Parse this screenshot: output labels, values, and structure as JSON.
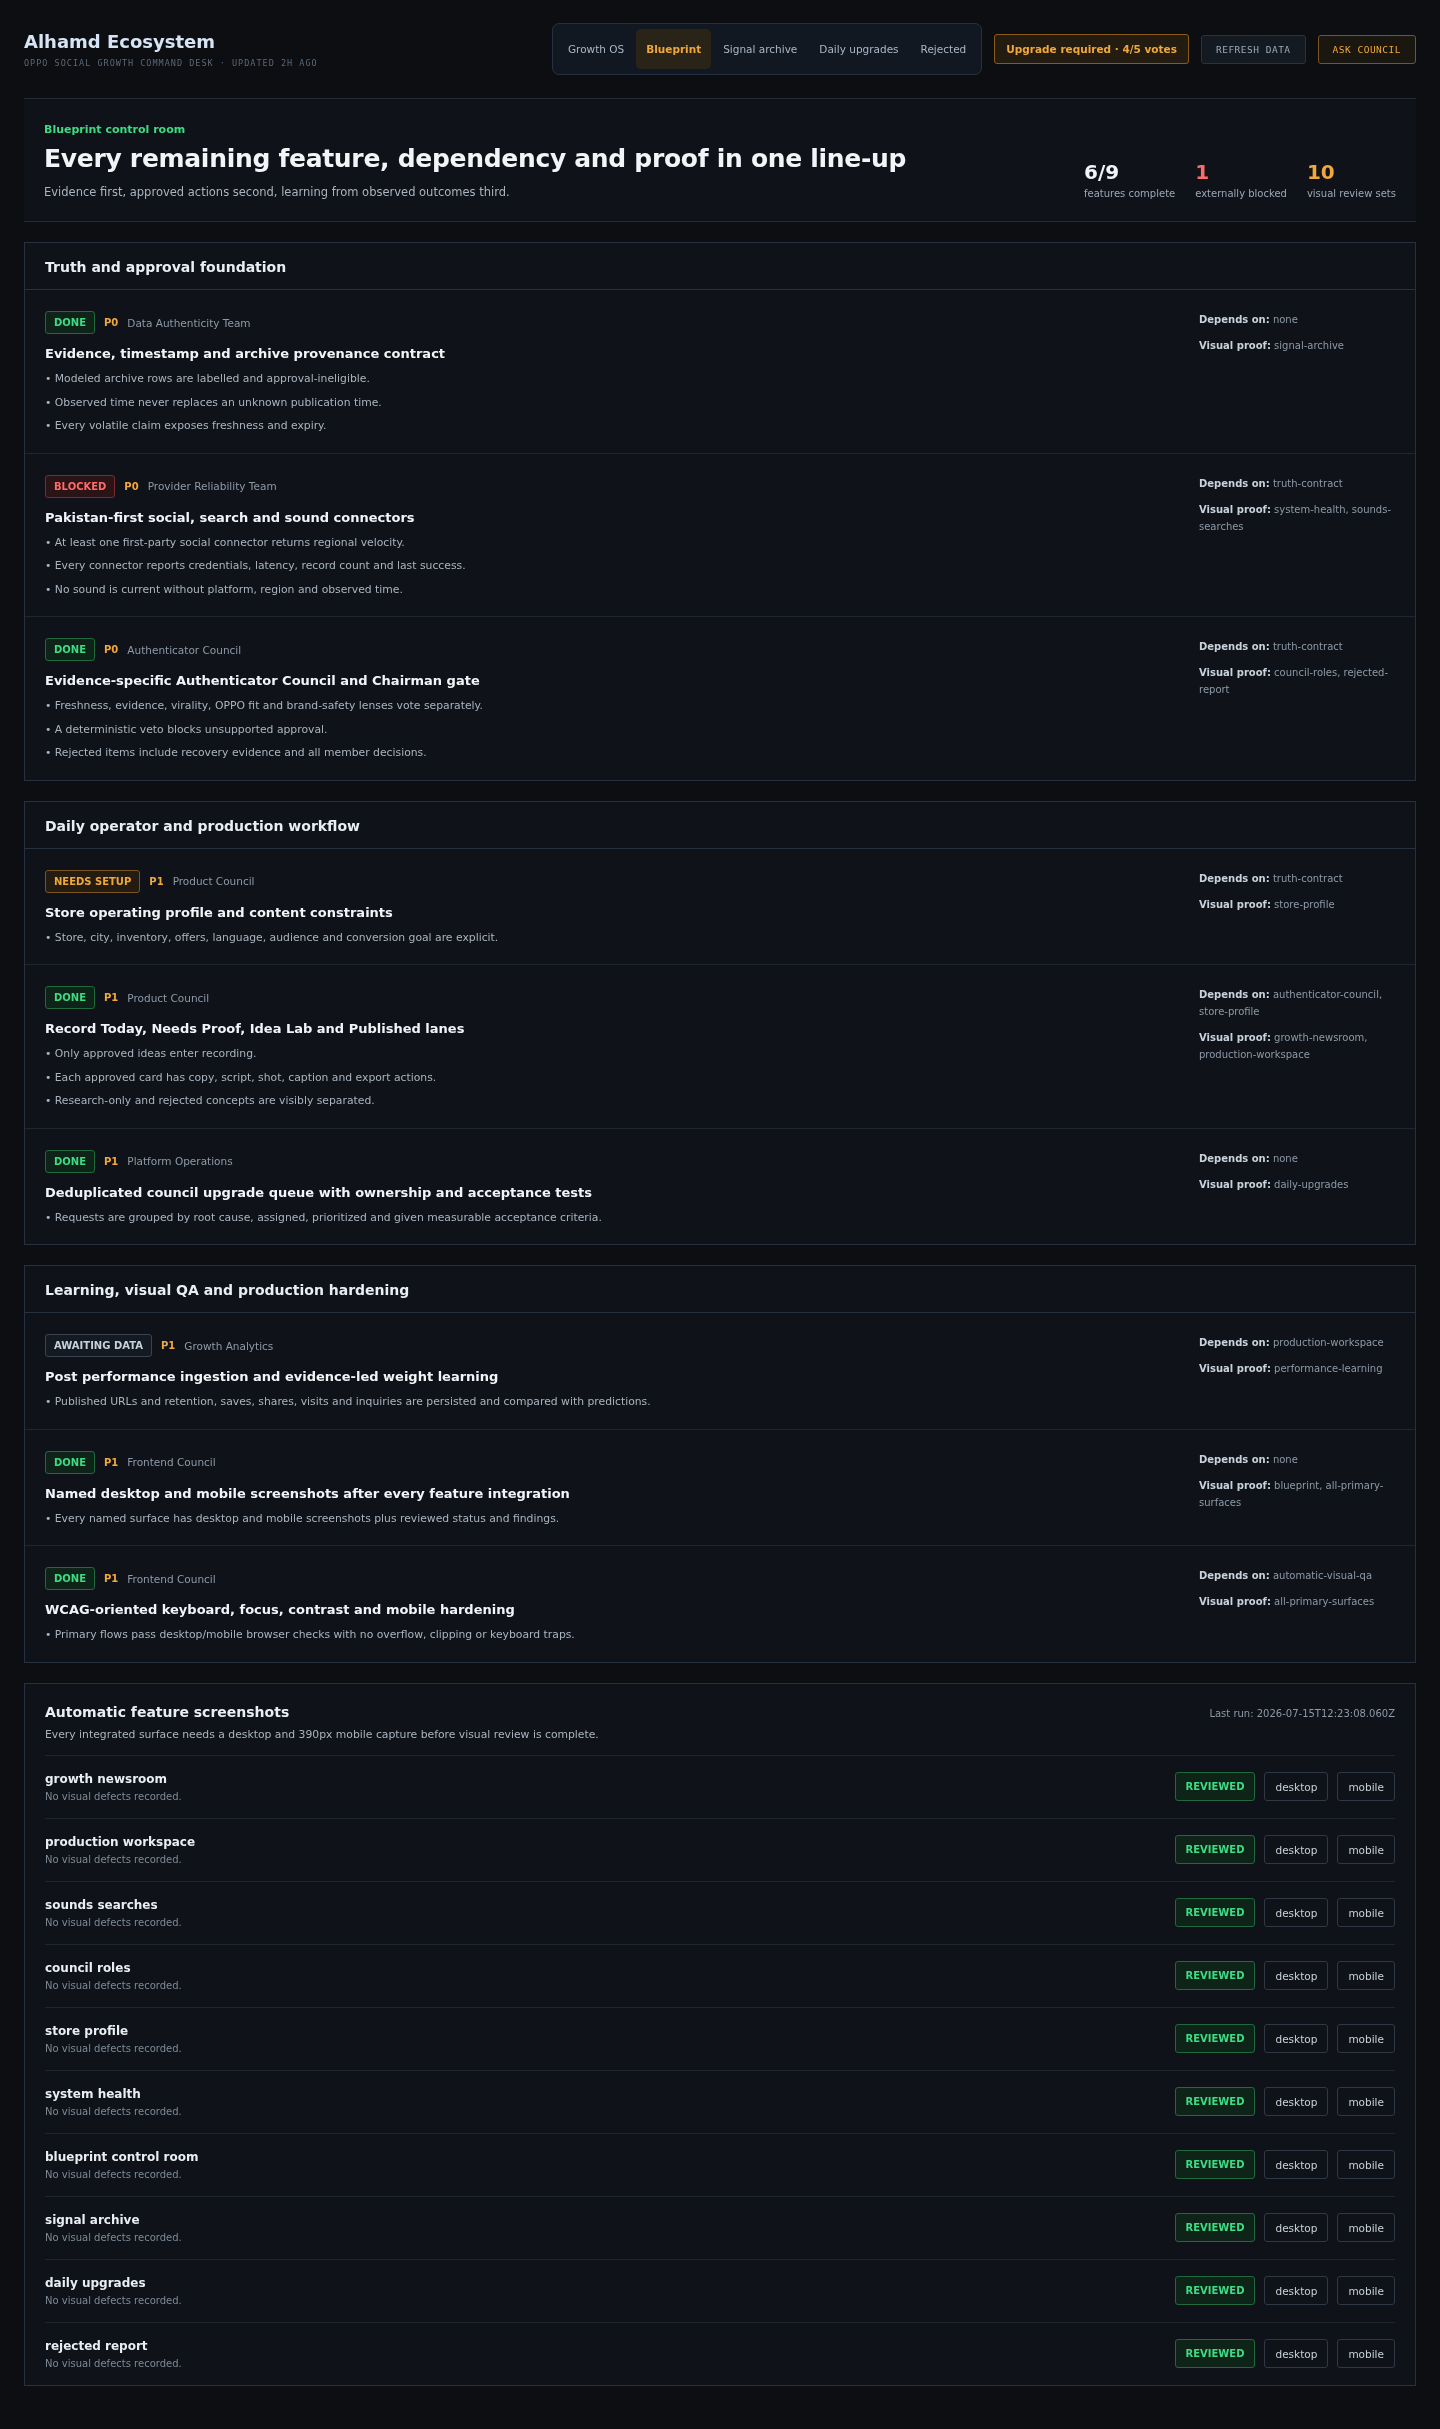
{
  "header": {
    "title": "Alhamd Ecosystem",
    "subtitle": "OPPO SOCIAL GROWTH COMMAND DESK · UPDATED 2H AGO",
    "tabs": [
      {
        "label": "Growth OS",
        "selected": false
      },
      {
        "label": "Blueprint",
        "selected": true
      },
      {
        "label": "Signal archive",
        "selected": false
      },
      {
        "label": "Daily upgrades",
        "selected": false
      },
      {
        "label": "Rejected",
        "selected": false
      }
    ],
    "upgrade_notice": "Upgrade required · 4/5 votes",
    "refresh_button": "REFRESH DATA",
    "ask_button": "ASK COUNCIL"
  },
  "hero": {
    "eyebrow": "Blueprint control room",
    "title": "Every remaining feature, dependency and proof in one line-up",
    "subtitle": "Evidence first, approved actions second, learning from observed outcomes third.",
    "stats": [
      {
        "value": "6/9",
        "label": "features complete",
        "kind": "neutral"
      },
      {
        "value": "1",
        "label": "externally blocked",
        "kind": "danger"
      },
      {
        "value": "10",
        "label": "visual review sets",
        "kind": "warning"
      }
    ]
  },
  "sections": [
    {
      "title": "Truth and approval foundation",
      "features": [
        {
          "kind": "done",
          "status_label": "DONE",
          "priority": "P0",
          "owner": "Data Authenticity Team",
          "title": "Evidence, timestamp and archive provenance contract",
          "bullets": [
            "• Modeled archive rows are labelled and approval-ineligible.",
            "• Observed time never replaces an unknown publication time.",
            "• Every volatile claim exposes freshness and expiry."
          ],
          "depends_label": "Depends on:",
          "depends": "none",
          "proof_label": "Visual proof:",
          "proof": "signal-archive"
        },
        {
          "kind": "blocked",
          "status_label": "BLOCKED",
          "priority": "P0",
          "owner": "Provider Reliability Team",
          "title": "Pakistan-first social, search and sound connectors",
          "bullets": [
            "• At least one first-party social connector returns regional velocity.",
            "• Every connector reports credentials, latency, record count and last success.",
            "• No sound is current without platform, region and observed time."
          ],
          "depends_label": "Depends on:",
          "depends": "truth-contract",
          "proof_label": "Visual proof:",
          "proof": "system-health, sounds-searches"
        },
        {
          "kind": "done",
          "status_label": "DONE",
          "priority": "P0",
          "owner": "Authenticator Council",
          "title": "Evidence-specific Authenticator Council and Chairman gate",
          "bullets": [
            "• Freshness, evidence, virality, OPPO fit and brand-safety lenses vote separately.",
            "• A deterministic veto blocks unsupported approval.",
            "• Rejected items include recovery evidence and all member decisions."
          ],
          "depends_label": "Depends on:",
          "depends": "truth-contract",
          "proof_label": "Visual proof:",
          "proof": "council-roles, rejected-report"
        }
      ]
    },
    {
      "title": "Daily operator and production workflow",
      "features": [
        {
          "kind": "needs_setup",
          "status_label": "NEEDS SETUP",
          "priority": "P1",
          "owner": "Product Council",
          "title": "Store operating profile and content constraints",
          "bullets": [
            "• Store, city, inventory, offers, language, audience and conversion goal are explicit."
          ],
          "depends_label": "Depends on:",
          "depends": "truth-contract",
          "proof_label": "Visual proof:",
          "proof": "store-profile"
        },
        {
          "kind": "done",
          "status_label": "DONE",
          "priority": "P1",
          "owner": "Product Council",
          "title": "Record Today, Needs Proof, Idea Lab and Published lanes",
          "bullets": [
            "• Only approved ideas enter recording.",
            "• Each approved card has copy, script, shot, caption and export actions.",
            "• Research-only and rejected concepts are visibly separated."
          ],
          "depends_label": "Depends on:",
          "depends": "authenticator-council, store-profile",
          "proof_label": "Visual proof:",
          "proof": "growth-newsroom, production-workspace"
        },
        {
          "kind": "done",
          "status_label": "DONE",
          "priority": "P1",
          "owner": "Platform Operations",
          "title": "Deduplicated council upgrade queue with ownership and acceptance tests",
          "bullets": [
            "• Requests are grouped by root cause, assigned, prioritized and given measurable acceptance criteria."
          ],
          "depends_label": "Depends on:",
          "depends": "none",
          "proof_label": "Visual proof:",
          "proof": "daily-upgrades"
        }
      ]
    },
    {
      "title": "Learning, visual QA and production hardening",
      "features": [
        {
          "kind": "awaiting_data",
          "status_label": "AWAITING DATA",
          "priority": "P1",
          "owner": "Growth Analytics",
          "title": "Post performance ingestion and evidence-led weight learning",
          "bullets": [
            "• Published URLs and retention, saves, shares, visits and inquiries are persisted and compared with predictions."
          ],
          "depends_label": "Depends on:",
          "depends": "production-workspace",
          "proof_label": "Visual proof:",
          "proof": "performance-learning"
        },
        {
          "kind": "done",
          "status_label": "DONE",
          "priority": "P1",
          "owner": "Frontend Council",
          "title": "Named desktop and mobile screenshots after every feature integration",
          "bullets": [
            "• Every named surface has desktop and mobile screenshots plus reviewed status and findings."
          ],
          "depends_label": "Depends on:",
          "depends": "none",
          "proof_label": "Visual proof:",
          "proof": "blueprint, all-primary-surfaces"
        },
        {
          "kind": "done",
          "status_label": "DONE",
          "priority": "P1",
          "owner": "Frontend Council",
          "title": "WCAG-oriented keyboard, focus, contrast and mobile hardening",
          "bullets": [
            "• Primary flows pass desktop/mobile browser checks with no overflow, clipping or keyboard traps."
          ],
          "depends_label": "Depends on:",
          "depends": "automatic-visual-qa",
          "proof_label": "Visual proof:",
          "proof": "all-primary-surfaces"
        }
      ]
    }
  ],
  "screenshots": {
    "title": "Automatic feature screenshots",
    "subtitle": "Every integrated surface needs a desktop and 390px mobile capture before visual review is complete.",
    "last_run": "Last run: 2026-07-15T12:23:08.060Z",
    "rows": [
      {
        "name": "growth newsroom",
        "note": "No visual defects recorded.",
        "kind": "reviewed",
        "status_label": "REVIEWED",
        "desktop": "desktop",
        "mobile": "mobile"
      },
      {
        "name": "production workspace",
        "note": "No visual defects recorded.",
        "kind": "reviewed",
        "status_label": "REVIEWED",
        "desktop": "desktop",
        "mobile": "mobile"
      },
      {
        "name": "sounds searches",
        "note": "No visual defects recorded.",
        "kind": "reviewed",
        "status_label": "REVIEWED",
        "desktop": "desktop",
        "mobile": "mobile"
      },
      {
        "name": "council roles",
        "note": "No visual defects recorded.",
        "kind": "reviewed",
        "status_label": "REVIEWED",
        "desktop": "desktop",
        "mobile": "mobile"
      },
      {
        "name": "store profile",
        "note": "No visual defects recorded.",
        "kind": "reviewed",
        "status_label": "REVIEWED",
        "desktop": "desktop",
        "mobile": "mobile"
      },
      {
        "name": "system health",
        "note": "No visual defects recorded.",
        "kind": "reviewed",
        "status_label": "REVIEWED",
        "desktop": "desktop",
        "mobile": "mobile"
      },
      {
        "name": "blueprint control room",
        "note": "No visual defects recorded.",
        "kind": "reviewed",
        "status_label": "REVIEWED",
        "desktop": "desktop",
        "mobile": "mobile"
      },
      {
        "name": "signal archive",
        "note": "No visual defects recorded.",
        "kind": "reviewed",
        "status_label": "REVIEWED",
        "desktop": "desktop",
        "mobile": "mobile"
      },
      {
        "name": "daily upgrades",
        "note": "No visual defects recorded.",
        "kind": "reviewed",
        "status_label": "REVIEWED",
        "desktop": "desktop",
        "mobile": "mobile"
      },
      {
        "name": "rejected report",
        "note": "No visual defects recorded.",
        "kind": "reviewed",
        "status_label": "REVIEWED",
        "desktop": "desktop",
        "mobile": "mobile"
      }
    ]
  }
}
